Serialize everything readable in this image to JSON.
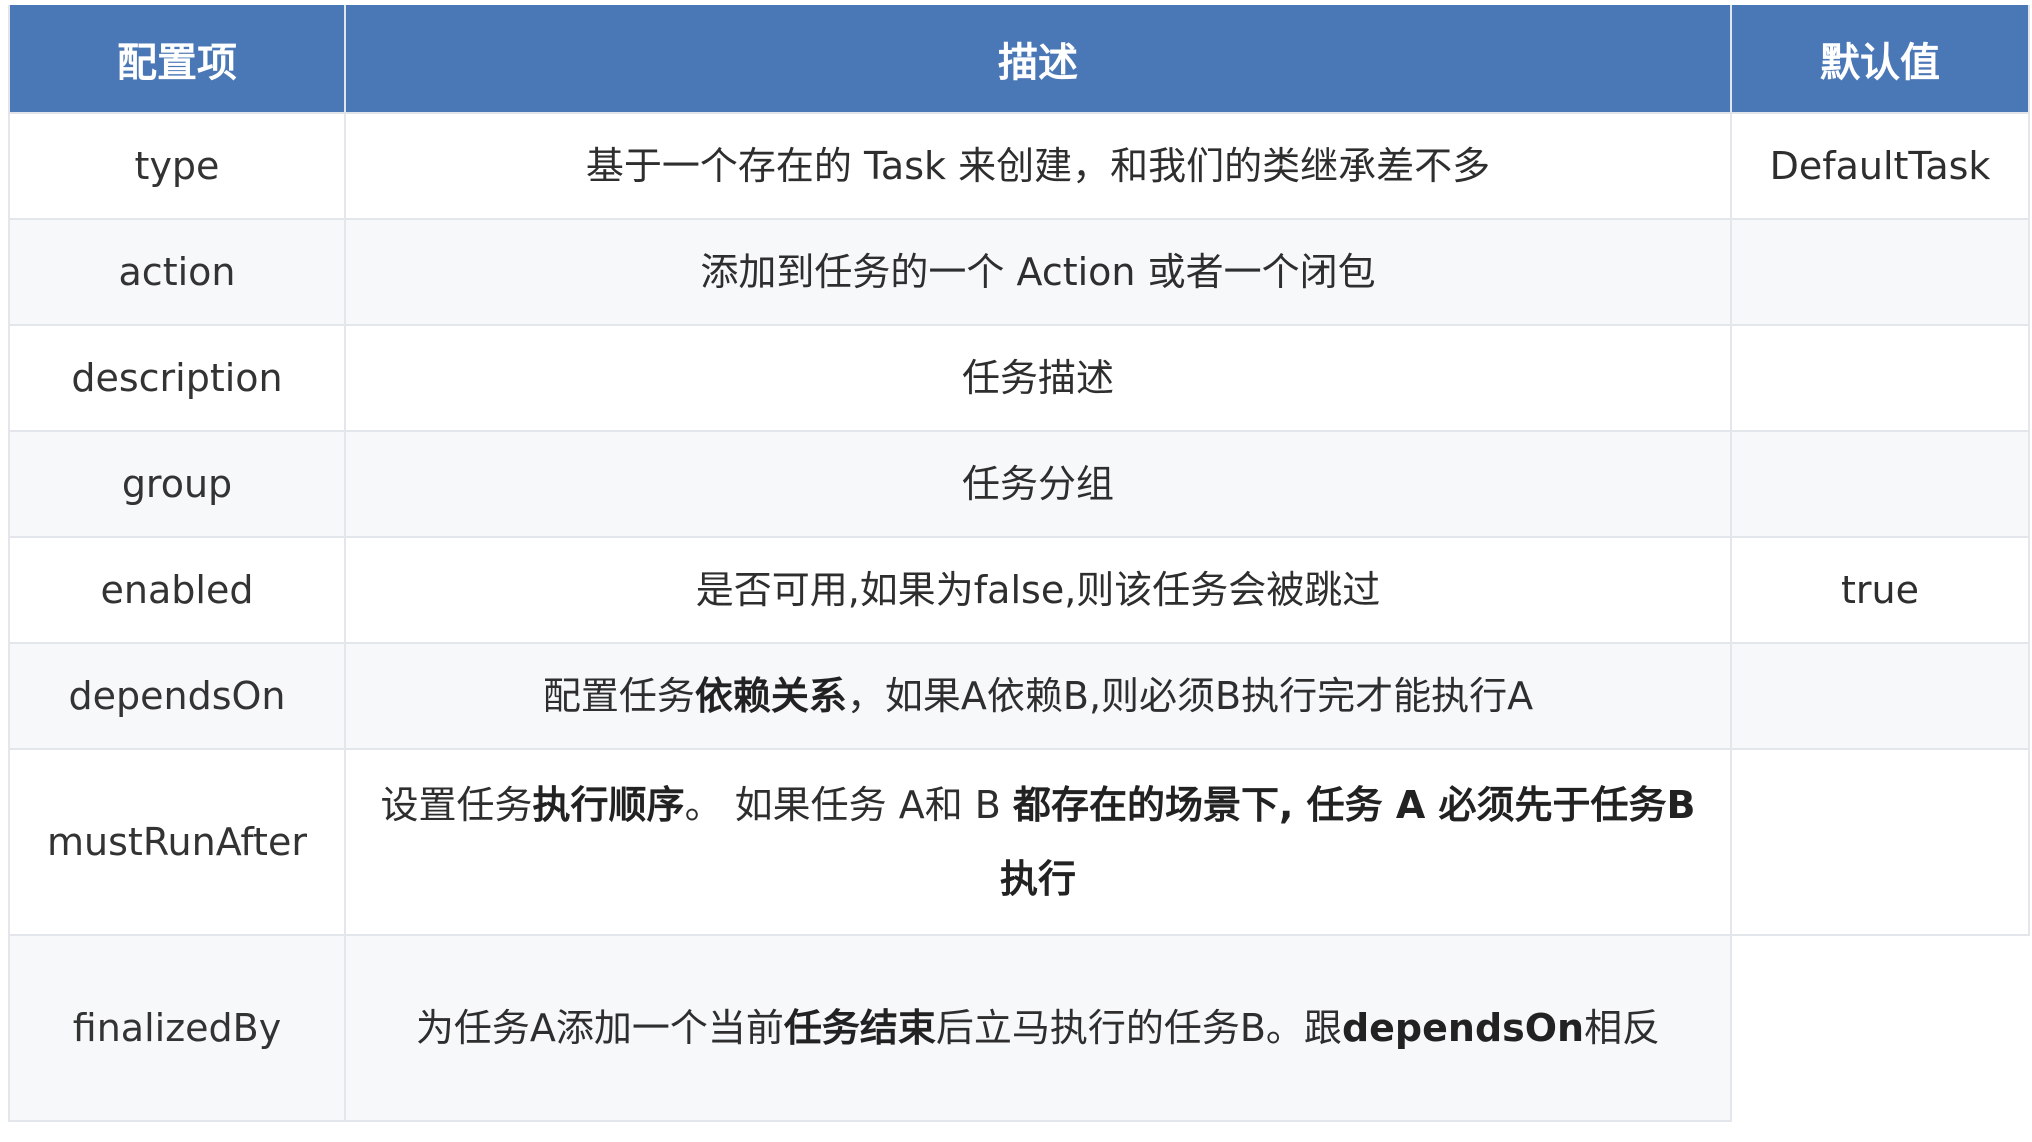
{
  "headers": [
    "配置项",
    "描述",
    "默认值"
  ],
  "rows": [
    {
      "name": "type",
      "desc": [
        {
          "t": "基于一个存在的 Task 来创建，和我们的类继承差不多",
          "b": false
        }
      ],
      "default": "DefaultTask"
    },
    {
      "name": "action",
      "desc": [
        {
          "t": "添加到任务的一个 Action 或者一个闭包",
          "b": false
        }
      ],
      "default": ""
    },
    {
      "name": "description",
      "desc": [
        {
          "t": "任务描述",
          "b": false
        }
      ],
      "default": ""
    },
    {
      "name": "group",
      "desc": [
        {
          "t": "任务分组",
          "b": false
        }
      ],
      "default": ""
    },
    {
      "name": "enabled",
      "desc": [
        {
          "t": "是否可用,如果为false,则该任务会被跳过",
          "b": false
        }
      ],
      "default": "true"
    },
    {
      "name": "dependsOn",
      "desc": [
        {
          "t": "配置任务",
          "b": false
        },
        {
          "t": "依赖关系",
          "b": true
        },
        {
          "t": "，如果A依赖B,则必须B执行完才能执行A",
          "b": false
        }
      ],
      "default": ""
    },
    {
      "name": "mustRunAfter",
      "desc": [
        {
          "t": "设置任务",
          "b": false
        },
        {
          "t": "执行顺序",
          "b": true
        },
        {
          "t": "。 如果任务 A和 B ",
          "b": false
        },
        {
          "t": "都存在的场景下, 任务 A 必须先于任务B 执行",
          "b": true
        }
      ],
      "default": ""
    },
    {
      "name": "finalizedBy",
      "desc": [
        {
          "t": "为任务A添加一个当前",
          "b": false
        },
        {
          "t": "任务结束",
          "b": true
        },
        {
          "t": "后立马执行的任务B。跟",
          "b": false
        },
        {
          "t": "dependsOn",
          "b": true
        },
        {
          "t": "相反",
          "b": false
        }
      ],
      "default": ""
    }
  ]
}
